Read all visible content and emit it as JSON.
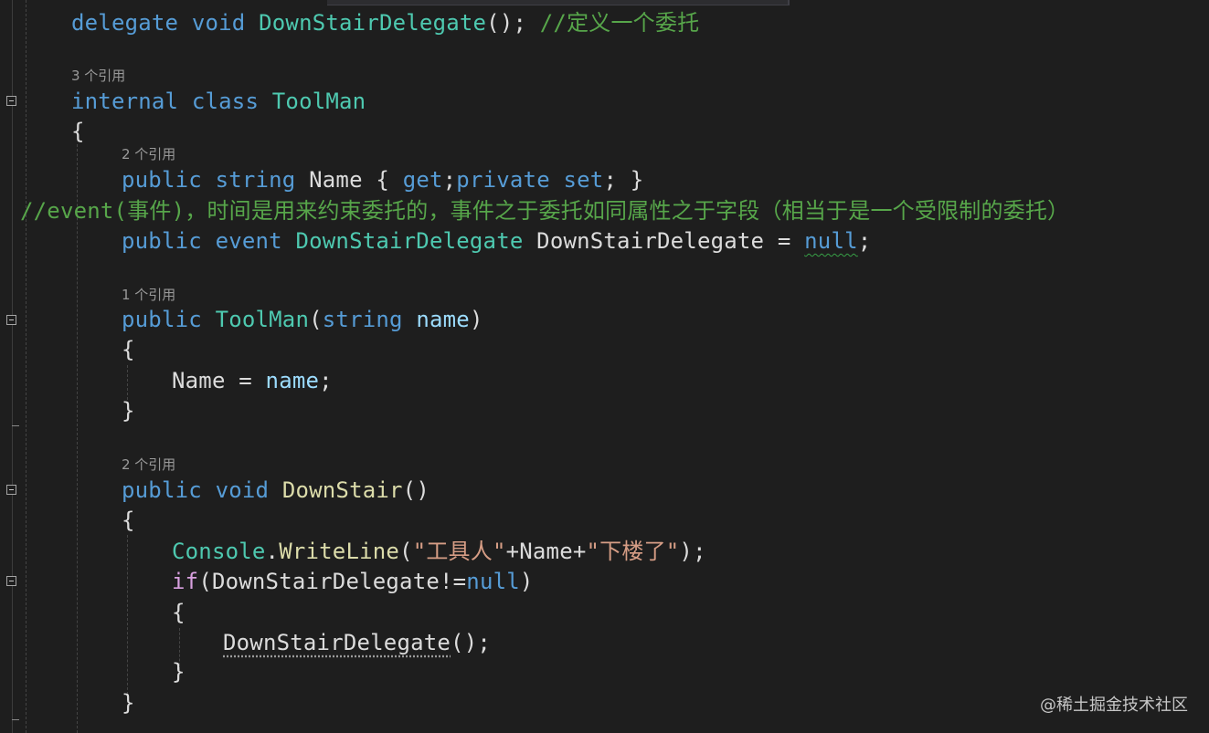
{
  "editor": {
    "lines": {
      "l1": [
        "delegate",
        " ",
        "void",
        " ",
        "DownStairDelegate",
        "(); ",
        "//定义一个委托"
      ],
      "lens_class": "3 个引用",
      "l2": [
        "internal",
        " ",
        "class",
        " ",
        "ToolMan"
      ],
      "l3": "{",
      "lens_name": "2 个引用",
      "l4": [
        "public",
        " ",
        "string",
        " ",
        "Name",
        " { ",
        "get",
        ";",
        "private",
        " ",
        "set",
        "; }"
      ],
      "comment_event": "//event(事件)，时间是用来约束委托的，事件之于委托如同属性之于字段（相当于是一个受限制的委托）",
      "l5": [
        "public",
        " ",
        "event",
        " ",
        "DownStairDelegate",
        " DownStairDelegate = ",
        "null",
        ";"
      ],
      "lens_ctor": "1 个引用",
      "l6": [
        "public",
        " ",
        "ToolMan",
        "(",
        "string",
        " ",
        "name",
        ")"
      ],
      "l7": "{",
      "l8": [
        "Name = ",
        "name",
        ";"
      ],
      "l9": "}",
      "lens_method": "2 个引用",
      "l10": [
        "public",
        " ",
        "void",
        " ",
        "DownStair",
        "()"
      ],
      "l11": "{",
      "l12": [
        "Console",
        ".",
        "WriteLine",
        "(",
        "\"工具人\"",
        "+Name+",
        "\"下楼了\"",
        ");"
      ],
      "l13": [
        "if",
        "(DownStairDelegate!=",
        "null",
        ")"
      ],
      "l14": "{",
      "l15": [
        "DownStairDelegate",
        "();"
      ],
      "l16": "}",
      "l17": "}"
    }
  },
  "watermark": "@稀土掘金技术社区",
  "colors": {
    "background": "#1e1e1e",
    "keyword": "#569cd6",
    "type": "#4ec9b0",
    "comment": "#57a64a",
    "string": "#d69d85",
    "method": "#dcdcaa",
    "parameter": "#9cdcfe",
    "control": "#d8a0df",
    "plain": "#dcdcdc"
  }
}
